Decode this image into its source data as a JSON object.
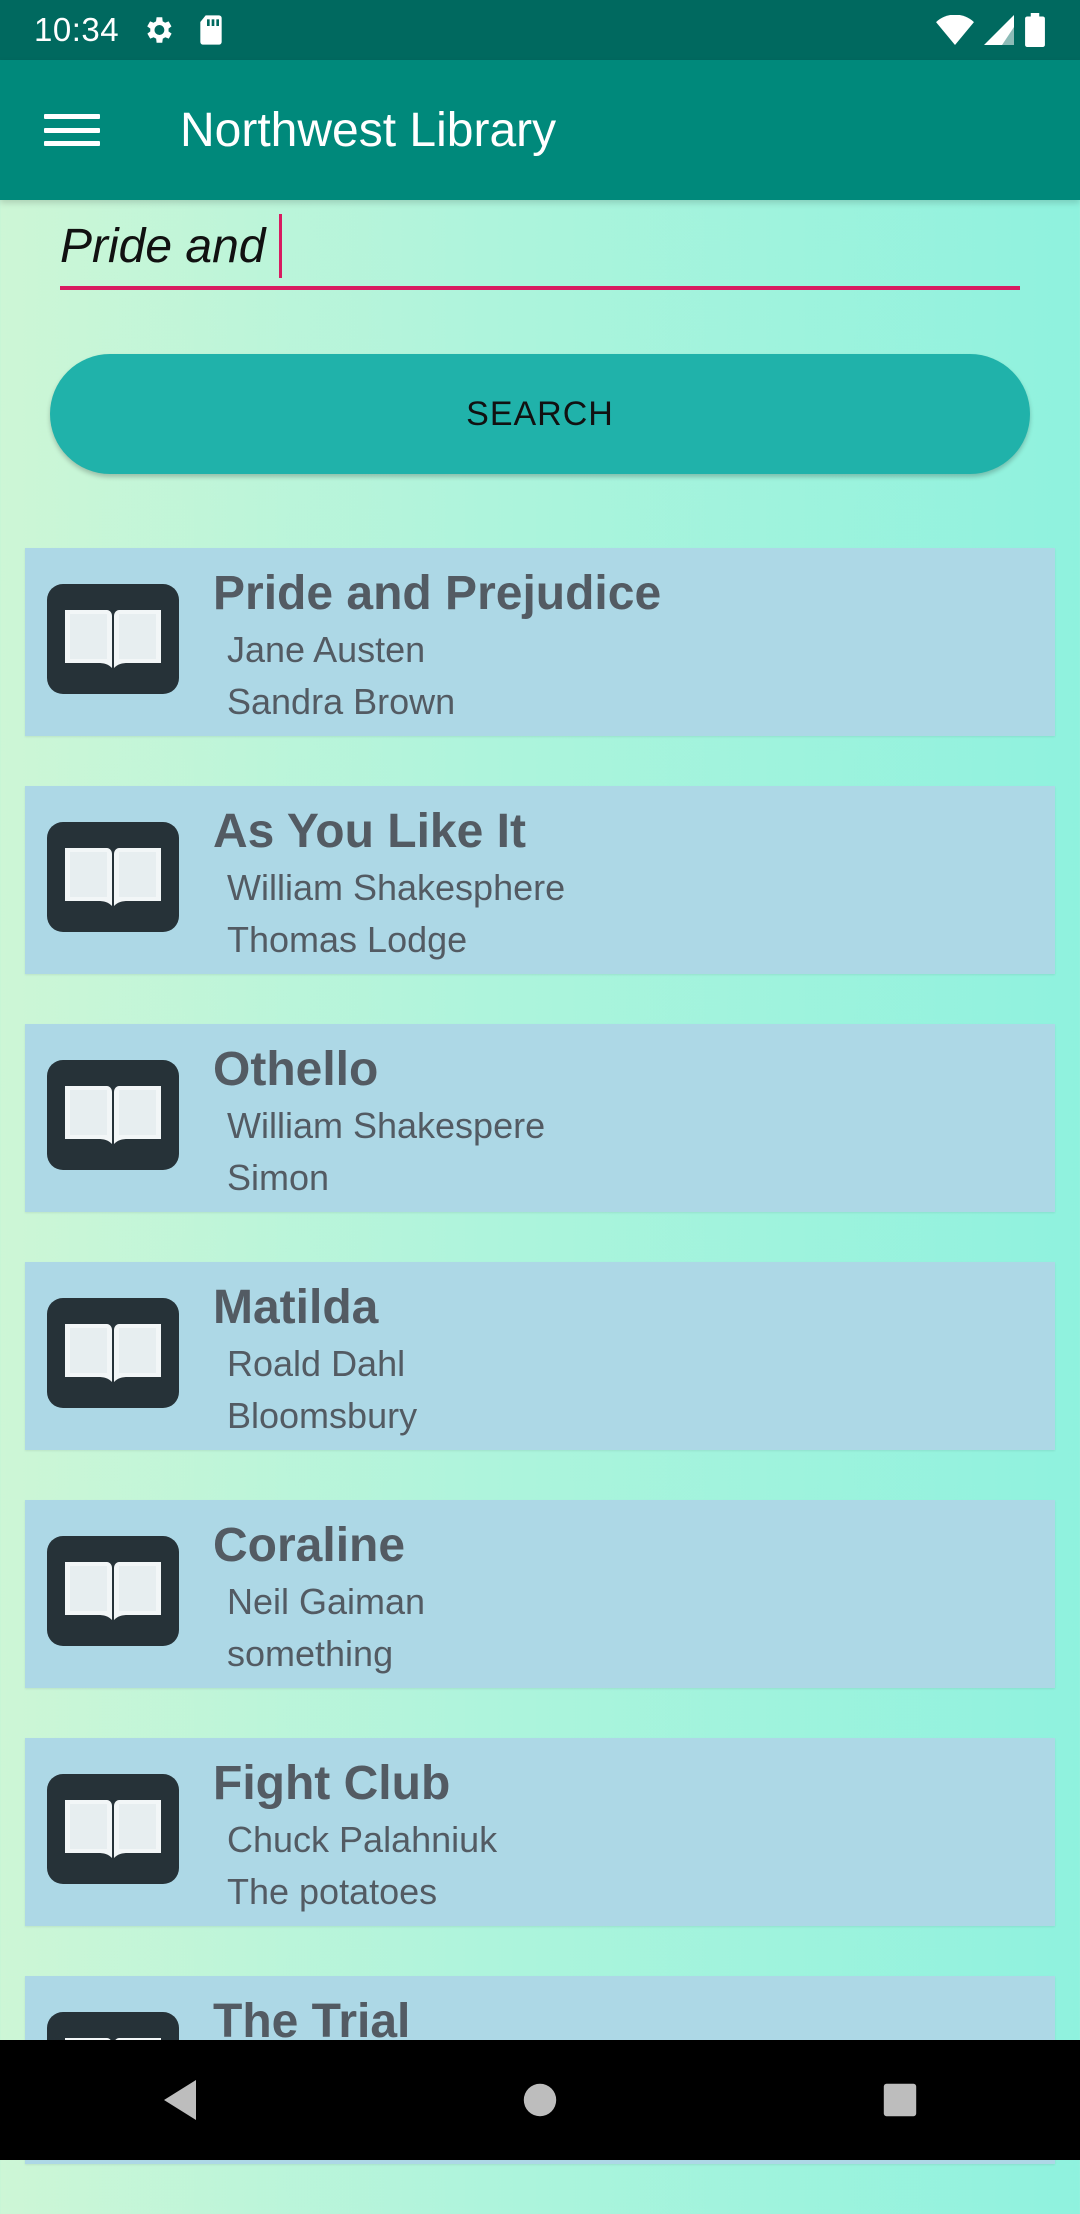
{
  "status_bar": {
    "time": "10:34",
    "icons": [
      "gear-icon",
      "sd-card-icon",
      "wifi-icon",
      "signal-icon",
      "battery-icon"
    ]
  },
  "app_bar": {
    "title": "Northwest Library",
    "menu_icon": "hamburger-menu-icon"
  },
  "search": {
    "value": "Pride and",
    "button_label": "SEARCH"
  },
  "books": [
    {
      "title": "Pride and Prejudice",
      "line1": "Jane Austen",
      "line2": "Sandra Brown"
    },
    {
      "title": "As You Like It",
      "line1": "William Shakesphere",
      "line2": "Thomas Lodge"
    },
    {
      "title": "Othello",
      "line1": "William Shakespere",
      "line2": "Simon"
    },
    {
      "title": "Matilda",
      "line1": "Roald Dahl",
      "line2": "Bloomsbury"
    },
    {
      "title": "Coraline",
      "line1": "Neil Gaiman",
      "line2": "something"
    },
    {
      "title": "Fight Club",
      "line1": "Chuck Palahniuk",
      "line2": "The potatoes"
    },
    {
      "title": "The Trial",
      "line1": "",
      "line2": ""
    }
  ],
  "nav_bar": {
    "icons": [
      "back-icon",
      "home-icon",
      "recents-icon"
    ]
  },
  "colors": {
    "status_bar": "#00695f",
    "app_bar": "#00897b",
    "accent": "#d81b60",
    "button": "#20b2aa",
    "card": "#add8e6"
  }
}
